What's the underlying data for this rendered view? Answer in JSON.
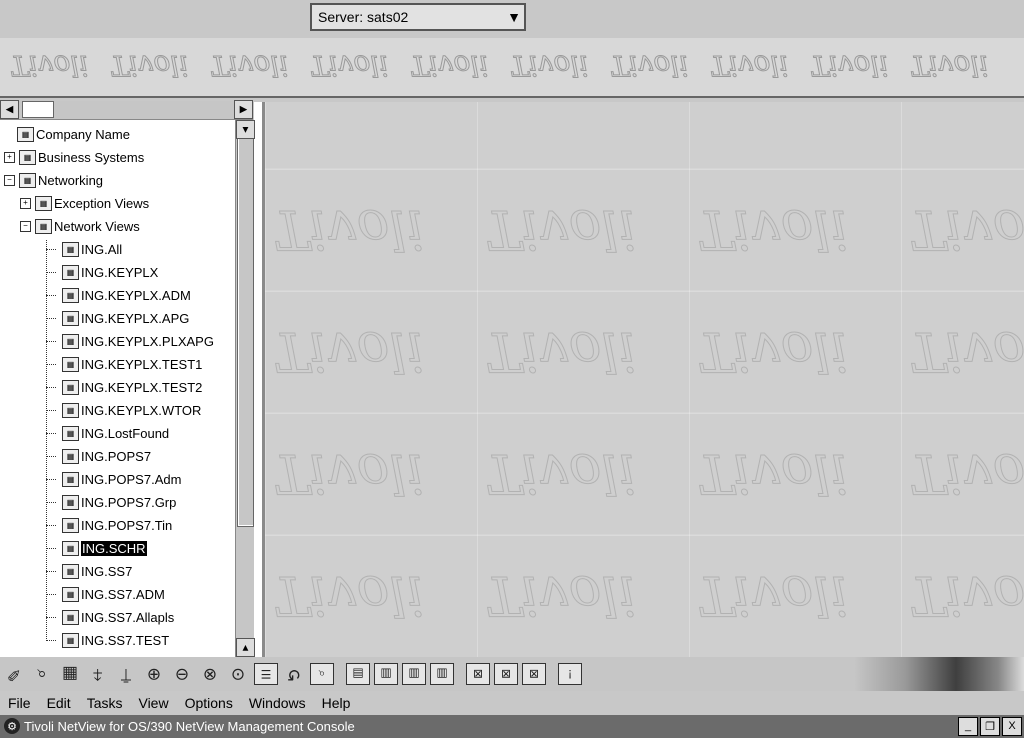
{
  "window": {
    "title": "Tivoli NetView for OS/390 NetView Management Console",
    "controls": {
      "minimize": "_",
      "restore": "❐",
      "close": "X"
    }
  },
  "menu": [
    "File",
    "Edit",
    "Tasks",
    "View",
    "Options",
    "Windows",
    "Help"
  ],
  "toolbar": {
    "icons": [
      "select-icon",
      "drag-icon",
      "view-icon",
      "locate-icon",
      "up-icon",
      "zoom-in-icon",
      "zoom-out-icon",
      "zoom-fit-icon",
      "zoom-icon",
      "list-icon",
      "refresh-icon",
      "find-icon",
      "properties-icon",
      "layout-icon",
      "layout2-icon",
      "layout3-icon",
      "delete-icon",
      "delete2-icon",
      "delete3-icon",
      "help-icon"
    ]
  },
  "tree": {
    "nodes": [
      {
        "label": "Company Name",
        "icon": "company-icon",
        "depth": 0,
        "expander": ""
      },
      {
        "label": "Business Systems",
        "icon": "business-icon",
        "depth": 0,
        "expander": "+"
      },
      {
        "label": "Networking",
        "icon": "network-icon",
        "depth": 0,
        "expander": "−"
      },
      {
        "label": "Exception Views",
        "icon": "view-icon",
        "depth": 1,
        "expander": "+"
      },
      {
        "label": "Network Views",
        "icon": "view-icon",
        "depth": 1,
        "expander": "−"
      },
      {
        "label": "ING.All",
        "depth": 2
      },
      {
        "label": "ING.KEYPLX",
        "depth": 2
      },
      {
        "label": "ING.KEYPLX.ADM",
        "depth": 2
      },
      {
        "label": "ING.KEYPLX.APG",
        "depth": 2
      },
      {
        "label": "ING.KEYPLX.PLXAPG",
        "depth": 2
      },
      {
        "label": "ING.KEYPLX.TEST1",
        "depth": 2
      },
      {
        "label": "ING.KEYPLX.TEST2",
        "depth": 2
      },
      {
        "label": "ING.KEYPLX.WTOR",
        "depth": 2
      },
      {
        "label": "ING.LostFound",
        "depth": 2
      },
      {
        "label": "ING.POPS7",
        "depth": 2
      },
      {
        "label": "ING.POPS7.Adm",
        "depth": 2
      },
      {
        "label": "ING.POPS7.Grp",
        "depth": 2
      },
      {
        "label": "ING.POPS7.Tin",
        "depth": 2
      },
      {
        "label": "ING.SCHR",
        "depth": 2,
        "selected": true
      },
      {
        "label": "ING.SS7",
        "depth": 2
      },
      {
        "label": "ING.SS7.ADM",
        "depth": 2
      },
      {
        "label": "ING.SS7.Allapls",
        "depth": 2
      },
      {
        "label": "ING.SS7.TEST",
        "depth": 2
      }
    ]
  },
  "server": {
    "label": "Server: sats02",
    "dropdown": "▼"
  }
}
